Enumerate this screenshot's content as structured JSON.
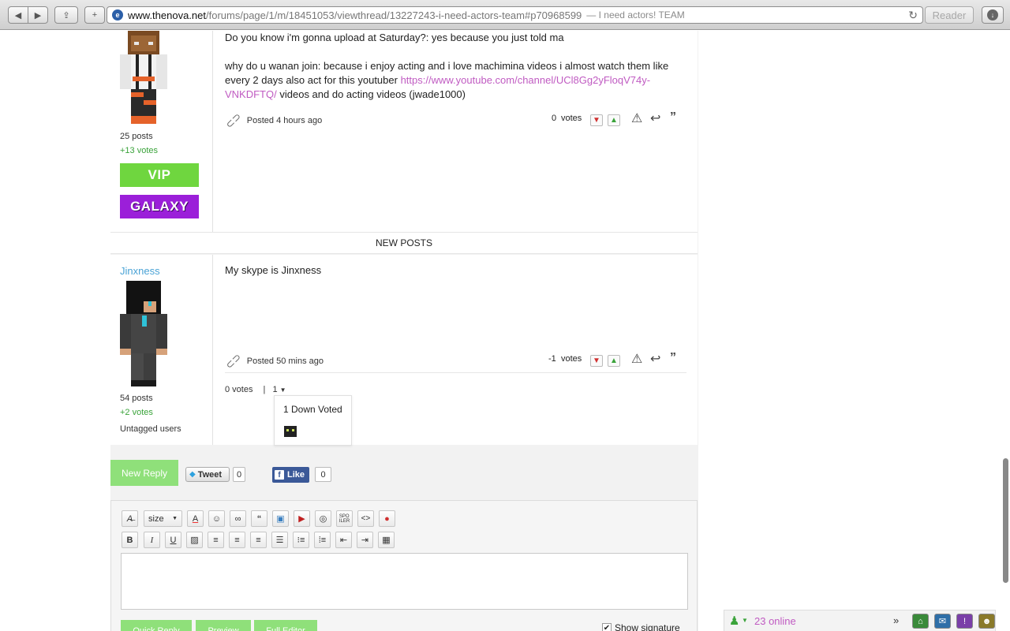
{
  "browser": {
    "url_host": "www.thenova.net",
    "url_path": "/forums/page/1/m/18451053/viewthread/13227243-i-need-actors-team#p70968599",
    "page_title": "— I need actors! TEAM",
    "reader_label": "Reader"
  },
  "post1": {
    "paragraph1": "Do you know i'm gonna upload at Saturday?: yes because you just told ma",
    "paragraph2_text": "why do u wanan join: because i enjoy acting and i love machimina videos i almost watch them like every 2 days also act for this youtuber",
    "paragraph2_link": "https://www.youtube.com/channel/UCl8Gg2yFloqV74y-VNKDFTQ/",
    "paragraph2_tail": "videos and do acting videos (jwade1000)",
    "posted": "Posted 4 hours ago",
    "votes_count": "0",
    "votes_label": "votes",
    "author_posts": "25 posts",
    "author_votes": "+13 votes",
    "badges": [
      "VIP",
      "GALAXY"
    ]
  },
  "divider": {
    "label": "NEW POSTS"
  },
  "post2": {
    "username": "Jinxness",
    "text": "My skype is Jinxness",
    "posted": "Posted 50 mins ago",
    "votes_count": "-1",
    "votes_label": "votes",
    "author_posts": "54 posts",
    "author_votes": "+2 votes",
    "author_tag": "Untagged users",
    "vote_detail_zero": "0 votes",
    "vote_detail_sep": "|",
    "vote_detail_dropdown": "1",
    "popup_title": "1 Down Voted"
  },
  "reply": {
    "new_reply": "New Reply",
    "tweet": "Tweet",
    "tweet_count": "0",
    "like": "Like",
    "like_count": "0",
    "size_label": "size",
    "quick_reply": "Quick Reply",
    "preview": "Preview",
    "full_editor": "Full Editor",
    "show_signature": "Show signature"
  },
  "chat": {
    "online": "23 online"
  },
  "colors": {
    "accent_link": "#c05bc2",
    "username": "#4aa3d6",
    "vip": "#6fd63f",
    "galaxy": "#9b1fd9",
    "button_green": "#8fe07a",
    "positive": "#3aa33a"
  }
}
